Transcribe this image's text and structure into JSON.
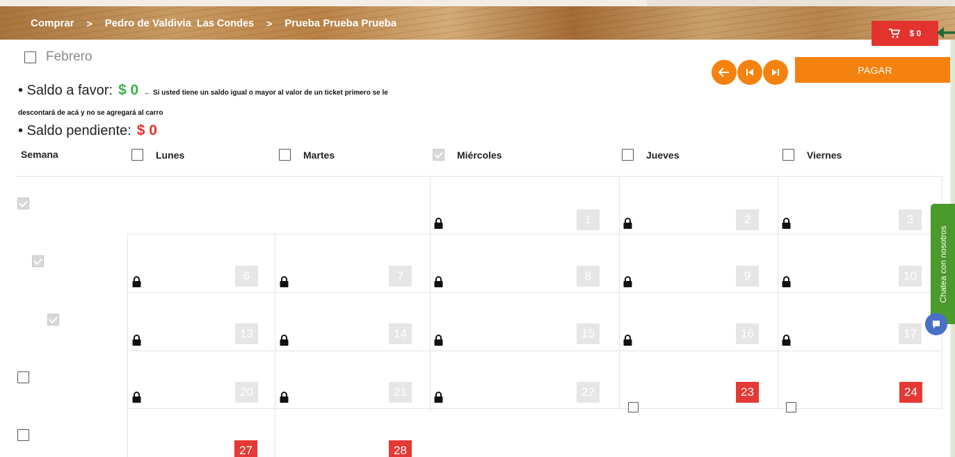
{
  "breadcrumb": {
    "items": [
      "Comprar",
      "Pedro de Valdivia",
      "Prueba Prueba Prueba"
    ],
    "sub": "Las Condes",
    "separator": ">"
  },
  "cart": {
    "label": "$ 0"
  },
  "month": {
    "label": "Febrero"
  },
  "nav": {
    "pay_label": "PAGAR"
  },
  "saldo": {
    "favor_label": "• Saldo a favor:",
    "favor_amount": "$ 0",
    "favor_note": "← Si usted tiene un saldo igual o mayor al valor de un ticket primero se le",
    "favor_note2": "descontará de acá y no se agregará al carro",
    "pending_label": "• Saldo pendiente:",
    "pending_amount": "$ 0"
  },
  "header": {
    "week": "Semana",
    "days": [
      "Lunes",
      "Martes",
      "Miércoles",
      "Jueves",
      "Viernes"
    ]
  },
  "days": {
    "d1": "1",
    "d2": "2",
    "d3": "3",
    "d6": "6",
    "d7": "7",
    "d8": "8",
    "d9": "9",
    "d10": "10",
    "d13": "13",
    "d14": "14",
    "d15": "15",
    "d16": "16",
    "d17": "17",
    "d20": "20",
    "d21": "21",
    "d22": "22",
    "d23": "23",
    "d24": "24",
    "d27": "27",
    "d28": "28"
  },
  "chat": {
    "label": "Chatea con nosotros"
  },
  "colors": {
    "accent": "#f5820f",
    "cart": "#e2332f",
    "favor": "#3cb14a",
    "pending": "#e2332f",
    "chat": "#4b9a2c"
  }
}
